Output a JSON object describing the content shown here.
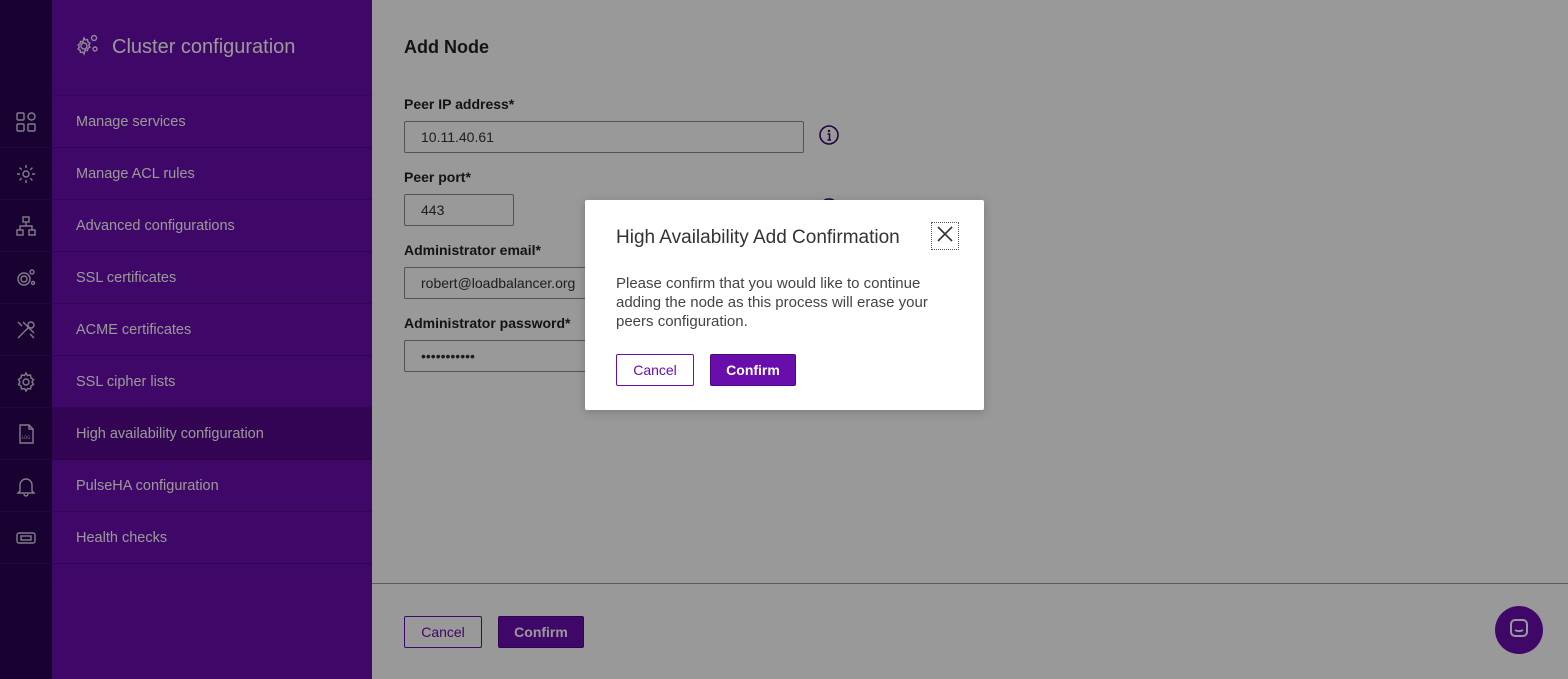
{
  "sidebar": {
    "title": "Cluster configuration",
    "items": [
      {
        "label": "Manage services",
        "icon": "grid-icon"
      },
      {
        "label": "Manage ACL rules",
        "icon": "gear-pin-icon"
      },
      {
        "label": "Advanced configurations",
        "icon": "network-icon"
      },
      {
        "label": "SSL certificates",
        "icon": "gears-icon"
      },
      {
        "label": "ACME certificates",
        "icon": "tools-icon"
      },
      {
        "label": "SSL cipher lists",
        "icon": "gear-icon"
      },
      {
        "label": "High availability configuration",
        "icon": "log-file-icon",
        "active": true
      },
      {
        "label": "PulseHA configuration",
        "icon": "bell-icon"
      },
      {
        "label": "Health checks",
        "icon": "ticket-icon"
      }
    ]
  },
  "main": {
    "title": "Add Node",
    "peer_ip_label": "Peer IP address*",
    "peer_ip_value": "10.11.40.61",
    "peer_port_label": "Peer port*",
    "peer_port_value": "443",
    "admin_email_label": "Administrator email*",
    "admin_email_value": "robert@loadbalancer.org",
    "admin_password_label": "Administrator password*",
    "admin_password_value": "•••••••••••",
    "cancel_label": "Cancel",
    "confirm_label": "Confirm"
  },
  "modal": {
    "title": "High Availability Add Confirmation",
    "line1": "Please confirm that you would like to continue",
    "line2": "adding the node as this process will erase your",
    "line3": "peers configuration.",
    "cancel_label": "Cancel",
    "confirm_label": "Confirm"
  },
  "colors": {
    "brand": "#6a0dad",
    "rail": "#2a0352"
  }
}
